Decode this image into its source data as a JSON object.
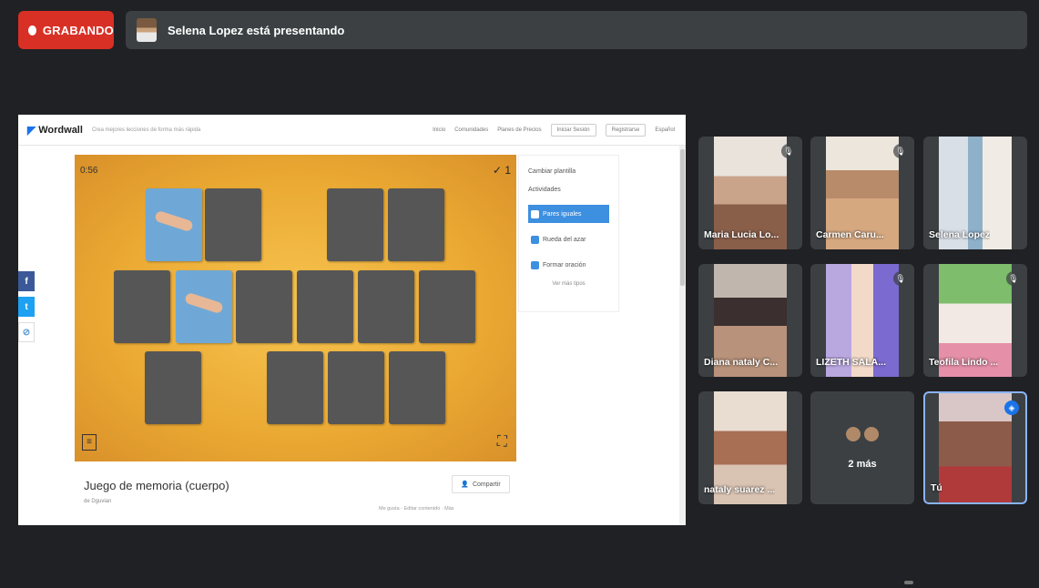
{
  "recording": {
    "label": "GRABANDO"
  },
  "presenter": {
    "text": "Selena Lopez está presentando"
  },
  "wordwall": {
    "logo": "Wordwall",
    "tagline": "Crea mejores lecciones de forma más rápida",
    "nav": [
      "Inicio",
      "Comunidades",
      "Planes de Precios"
    ],
    "login_label": "Iniciar Sesión",
    "register_label": "Registrarse",
    "language": "Español",
    "timer": "0:56",
    "score": "✓ 1",
    "side_panel": {
      "switch_template": "Cambiar plantilla",
      "interactives": "Actividades",
      "options": [
        "Pares iguales",
        "Rueda del azar",
        "Formar oración"
      ],
      "more": "Ver más tipos"
    },
    "game_title": "Juego de memoria (cuerpo)",
    "author": "de Dguvian",
    "share_label": "Compartir",
    "footer_links": "Me gusta · Editar contenido · Más"
  },
  "participants": [
    {
      "name": "Maria Lucia Lo...",
      "self": false
    },
    {
      "name": "Carmen Caru...",
      "self": false
    },
    {
      "name": "Selena Lopez",
      "self": false
    },
    {
      "name": "Diana nataly C...",
      "self": false
    },
    {
      "name": "LIZETH SALA...",
      "self": false
    },
    {
      "name": "Teofila Lindo ...",
      "self": false
    },
    {
      "name": "nataly suarez ...",
      "self": false
    },
    {
      "name": "Tú",
      "self": true
    }
  ],
  "more_participants": {
    "label": "2 más"
  },
  "colors": {
    "recording": "#d93025",
    "background": "#202124",
    "tile": "#3c4043",
    "accent": "#1a73e8"
  }
}
